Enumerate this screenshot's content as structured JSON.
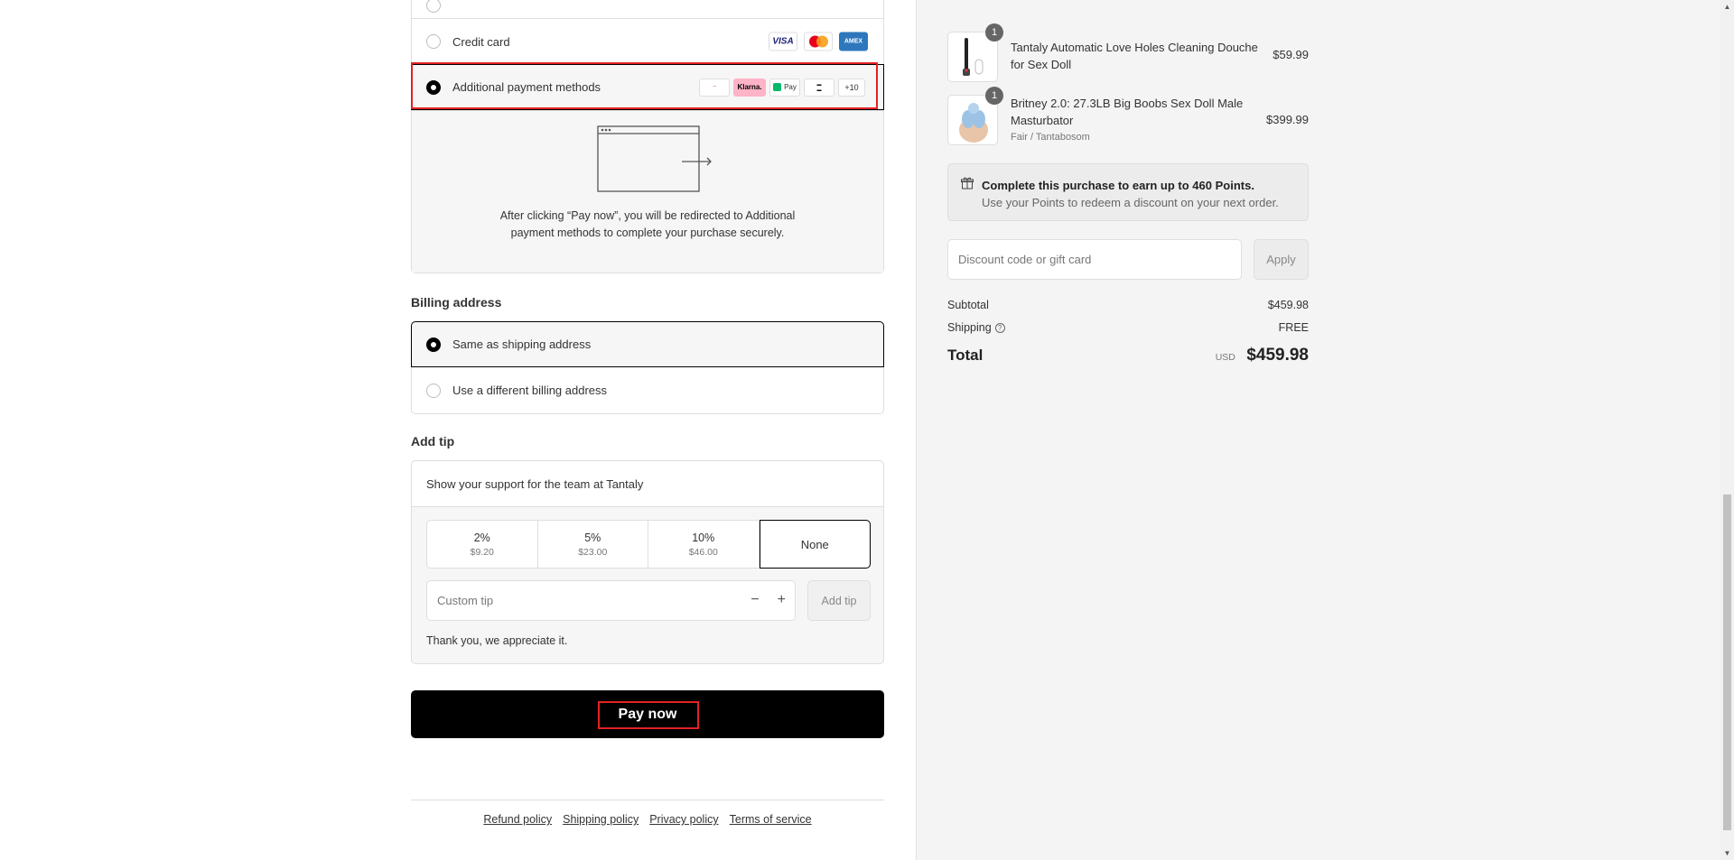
{
  "payment": {
    "credit_card_label": "Credit card",
    "card_brands": [
      "VISA",
      "AMEX"
    ],
    "apm_label": "Additional payment methods",
    "apm_logos": [
      "Klarna.",
      "Pay",
      "+10"
    ],
    "redirect_text": "After clicking “Pay now”, you will be redirected to Additional payment methods to complete your purchase securely."
  },
  "billing": {
    "heading": "Billing address",
    "same_label": "Same as shipping address",
    "different_label": "Use a different billing address"
  },
  "tip": {
    "heading": "Add tip",
    "support_text": "Show your support for the team at Tantaly",
    "options": [
      {
        "pct": "2%",
        "amt": "$9.20"
      },
      {
        "pct": "5%",
        "amt": "$23.00"
      },
      {
        "pct": "10%",
        "amt": "$46.00"
      }
    ],
    "none_label": "None",
    "custom_placeholder": "Custom tip",
    "add_label": "Add tip",
    "thanks": "Thank you, we appreciate it."
  },
  "pay_now_label": "Pay now",
  "footer_links": [
    "Refund policy",
    "Shipping policy",
    "Privacy policy",
    "Terms of service"
  ],
  "cart": {
    "items": [
      {
        "qty": "1",
        "name": "Tantaly Automatic Love Holes Cleaning Douche for Sex Doll",
        "variant": "",
        "price": "$59.99"
      },
      {
        "qty": "1",
        "name": "Britney 2.0: 27.3LB Big Boobs Sex Doll Male Masturbator",
        "variant": "Fair / Tantabosom",
        "price": "$399.99"
      }
    ],
    "points_title": "Complete this purchase to earn up to 460 Points.",
    "points_sub": "Use your Points to redeem a discount on your next order.",
    "discount_placeholder": "Discount code or gift card",
    "apply_label": "Apply",
    "subtotal_label": "Subtotal",
    "subtotal_value": "$459.98",
    "shipping_label": "Shipping",
    "shipping_value": "FREE",
    "total_label": "Total",
    "total_currency": "USD",
    "total_value": "$459.98"
  }
}
